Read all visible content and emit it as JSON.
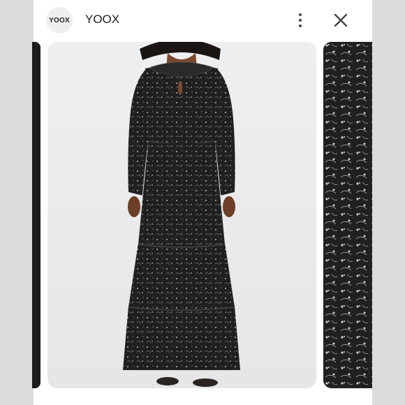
{
  "header": {
    "logo_text": "YOOX",
    "store_name": "YOOX",
    "menu_icon": "more-vert-icon",
    "close_icon": "close-icon"
  },
  "main_image": {
    "description_icon": "product-photo",
    "subject": "model-wearing-black-floral-tiered-maxi-dress"
  },
  "peek_image": {
    "subject": "dress-fabric-closeup"
  },
  "colors": {
    "background": "#ffffff",
    "side_strip": "#dcdcdc",
    "photo_bg": "#eeeeef",
    "dress": "#1f2022",
    "pattern": "#c9c9c9",
    "text": "#202124"
  }
}
